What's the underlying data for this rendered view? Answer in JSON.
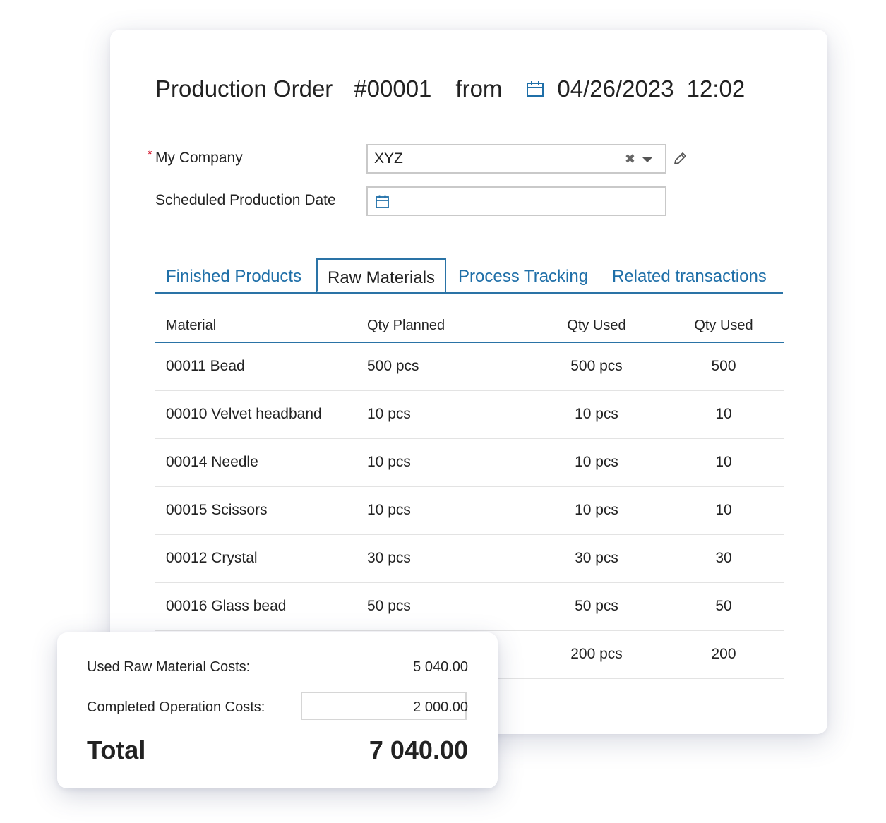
{
  "header": {
    "doc_type": "Production Order",
    "number": "#00001",
    "from": "from",
    "date": "04/26/2023",
    "time": "12:02"
  },
  "form": {
    "company_label": "My Company",
    "company_required": "*",
    "company_value": "XYZ",
    "clear_glyph": "✖",
    "scheduled_label": "Scheduled Production Date",
    "scheduled_value": ""
  },
  "tabs": [
    {
      "label": "Finished Products",
      "active": false
    },
    {
      "label": "Raw Materials",
      "active": true
    },
    {
      "label": "Process Tracking",
      "active": false
    },
    {
      "label": "Related transactions",
      "active": false
    }
  ],
  "table": {
    "columns": [
      "Material",
      "Qty Planned",
      "Qty Used",
      "Qty Used"
    ],
    "rows": [
      [
        "00011 Bead",
        "500 pcs",
        "500 pcs",
        "500"
      ],
      [
        "00010 Velvet headband",
        "10 pcs",
        "10 pcs",
        "10"
      ],
      [
        "00014 Needle",
        "10 pcs",
        "10 pcs",
        "10"
      ],
      [
        "00015 Scissors",
        "10 pcs",
        "10 pcs",
        "10"
      ],
      [
        "00012 Crystal",
        "30 pcs",
        "30 pcs",
        "30"
      ],
      [
        "00016 Glass bead",
        "50 pcs",
        "50 pcs",
        "50"
      ],
      [
        "",
        "",
        "200 pcs",
        "200"
      ]
    ]
  },
  "costs": {
    "used_label": "Used Raw Material Costs:",
    "used_value": "5 040.00",
    "operation_label": "Completed Operation Costs:",
    "operation_value": "2 000.00",
    "total_label": "Total",
    "total_value": "7 040.00"
  },
  "colors": {
    "accent": "#1f6fa8",
    "required": "#d0021b"
  }
}
